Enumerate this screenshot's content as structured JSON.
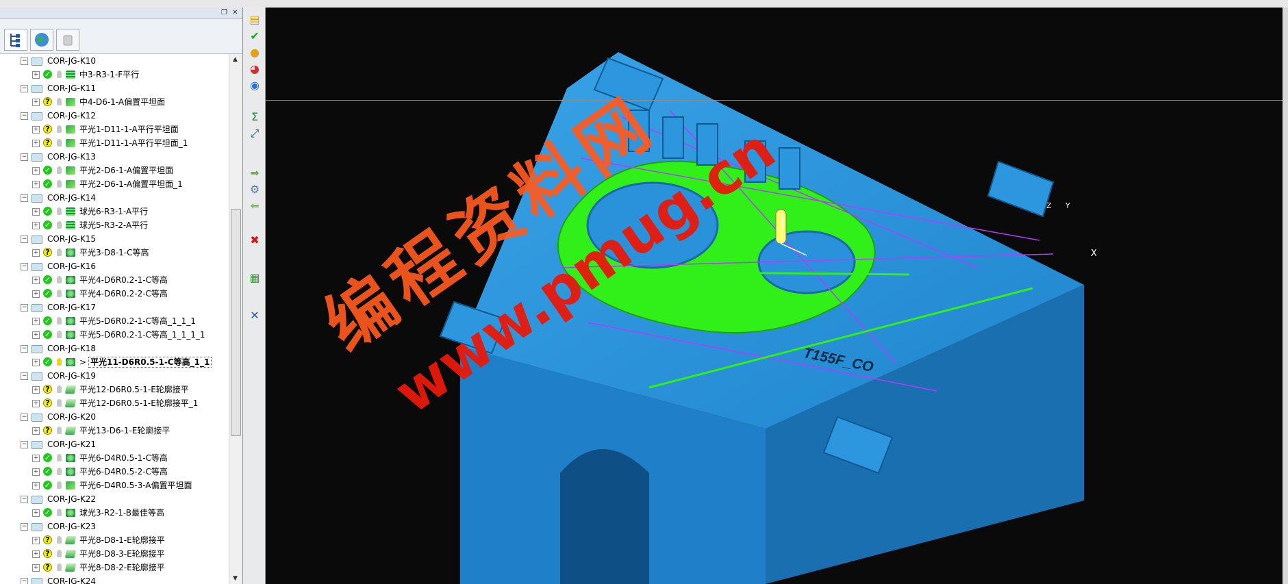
{
  "tree": [
    {
      "label": "COR-JG-K10",
      "children": [
        {
          "label": "中3-R3-1-F平行",
          "status": "ok",
          "icon": "stack"
        }
      ]
    },
    {
      "label": "COR-JG-K11",
      "children": [
        {
          "label": "中4-D6-1-A偏置平坦面",
          "status": "question",
          "icon": "offset"
        }
      ]
    },
    {
      "label": "COR-JG-K12",
      "children": [
        {
          "label": "平光1-D11-1-A平行平坦面",
          "status": "question",
          "icon": "offset"
        },
        {
          "label": "平光1-D11-1-A平行平坦面_1",
          "status": "question",
          "icon": "offset"
        }
      ]
    },
    {
      "label": "COR-JG-K13",
      "children": [
        {
          "label": "平光2-D6-1-A偏置平坦面",
          "status": "ok",
          "icon": "offset"
        },
        {
          "label": "平光2-D6-1-A偏置平坦面_1",
          "status": "ok",
          "icon": "offset"
        }
      ]
    },
    {
      "label": "COR-JG-K14",
      "children": [
        {
          "label": "球光6-R3-1-A平行",
          "status": "ok",
          "icon": "stack"
        },
        {
          "label": "球光5-R3-2-A平行",
          "status": "ok",
          "icon": "stack"
        }
      ]
    },
    {
      "label": "COR-JG-K15",
      "children": [
        {
          "label": "平光3-D8-1-C等高",
          "status": "question",
          "icon": "contour"
        }
      ]
    },
    {
      "label": "COR-JG-K16",
      "children": [
        {
          "label": "平光4-D6R0.2-1-C等高",
          "status": "ok",
          "icon": "contour"
        },
        {
          "label": "平光4-D6R0.2-2-C等高",
          "status": "ok",
          "icon": "contour"
        }
      ]
    },
    {
      "label": "COR-JG-K17",
      "children": [
        {
          "label": "平光5-D6R0.2-1-C等高_1_1_1",
          "status": "ok",
          "icon": "contour"
        },
        {
          "label": "平光5-D6R0.2-1-C等高_1_1_1_1",
          "status": "ok",
          "icon": "contour"
        }
      ]
    },
    {
      "label": "COR-JG-K18",
      "children": [
        {
          "label": "平光11-D6R0.5-1-C等高_1_1",
          "status": "ok",
          "icon": "contour",
          "active": true,
          "marker": ">"
        }
      ]
    },
    {
      "label": "COR-JG-K19",
      "children": [
        {
          "label": "平光12-D6R0.5-1-E轮廓接平",
          "status": "question",
          "icon": "profile"
        },
        {
          "label": "平光12-D6R0.5-1-E轮廓接平_1",
          "status": "question",
          "icon": "profile"
        }
      ]
    },
    {
      "label": "COR-JG-K20",
      "children": [
        {
          "label": "平光13-D6-1-E轮廓接平",
          "status": "question",
          "icon": "profile"
        }
      ]
    },
    {
      "label": "COR-JG-K21",
      "children": [
        {
          "label": "平光6-D4R0.5-1-C等高",
          "status": "ok",
          "icon": "contour"
        },
        {
          "label": "平光6-D4R0.5-2-C等高",
          "status": "ok",
          "icon": "contour"
        },
        {
          "label": "平光6-D4R0.5-3-A偏置平坦面",
          "status": "ok",
          "icon": "offset"
        }
      ]
    },
    {
      "label": "COR-JG-K22",
      "children": [
        {
          "label": "球光3-R2-1-B最佳等高",
          "status": "ok",
          "icon": "contour"
        }
      ]
    },
    {
      "label": "COR-JG-K23",
      "children": [
        {
          "label": "平光8-D8-1-E轮廓接平",
          "status": "question",
          "icon": "profile"
        },
        {
          "label": "平光8-D8-3-E轮廓接平",
          "status": "question",
          "icon": "profile"
        },
        {
          "label": "平光8-D8-2-E轮廓接平",
          "status": "question",
          "icon": "profile"
        }
      ]
    },
    {
      "label": "COR-JG-K24",
      "children": []
    }
  ],
  "viewport": {
    "part_label": "T155F_CO",
    "axis_labels": {
      "x": "X",
      "y": "Y",
      "z": "Z"
    },
    "watermark_line1": "编程资料网",
    "watermark_line2": "www.pmug.cn"
  },
  "panel_tabs": [
    "toolpath-tree-icon",
    "globe-icon",
    "bin-icon"
  ],
  "toolbar_icons": [
    "layers-icon",
    "checkmark-icon",
    "sphere-icon",
    "color-ball-icon",
    "globe-icon",
    "sigma-icon",
    "resize-icon",
    "forward-arrow-icon",
    "gear-icon",
    "back-arrow-icon",
    "delete-x-icon",
    "list-icon",
    "close-x-icon"
  ],
  "colors": {
    "viewport_bg": "#0a0a0a",
    "part_blue": "#2590d8",
    "toolpath_green": "#31f01a",
    "watermark": "#ff5a1f"
  }
}
